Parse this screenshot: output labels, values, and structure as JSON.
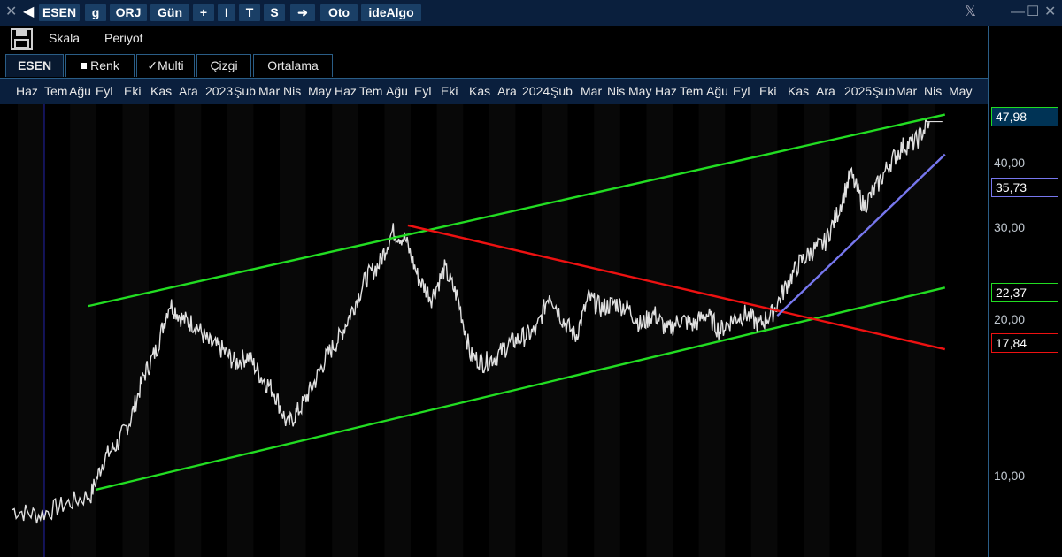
{
  "titlebar": {
    "buttons": [
      "ESEN",
      "g",
      "ORJ",
      "Gün",
      "+",
      "I",
      "T",
      "S",
      "Oto",
      "ideAlgo"
    ]
  },
  "toolbar": {
    "scale_label": "Skala",
    "period_label": "Periyot"
  },
  "tabs": [
    "ESEN",
    "Renk",
    "Multi",
    "Çizgi",
    "Ortalama"
  ],
  "months": [
    "Haz",
    "Tem",
    "Ağu",
    "Eyl",
    "Eki",
    "Kas",
    "Ara",
    "2023",
    "Şub",
    "Mar",
    "Nis",
    "May",
    "Haz",
    "Tem",
    "Ağu",
    "Eyl",
    "Eki",
    "Kas",
    "Ara",
    "2024",
    "Şub",
    "Mar",
    "Nis",
    "May",
    "Haz",
    "Tem",
    "Ağu",
    "Eyl",
    "Eki",
    "Kas",
    "Ara",
    "2025",
    "Şub",
    "Mar",
    "Nis",
    "May"
  ],
  "colors": {
    "upper_channel": "#22dd22",
    "lower_channel": "#22dd22",
    "resistance": "#ee1111",
    "support_trend": "#7777ee",
    "price": "#e0e0e0"
  },
  "chart_data": {
    "type": "line",
    "title": "",
    "xlabel": "",
    "ylabel": "",
    "scale": "log",
    "ylim": [
      8.5,
      52
    ],
    "y_ticks": [
      "10,00",
      "20,00",
      "30,00",
      "40,00"
    ],
    "y_tick_values": [
      10,
      20,
      30,
      40
    ],
    "x_start": "2022-06",
    "x_end": "2025-05",
    "series": [
      {
        "values": [
          [
            0,
            8.6
          ],
          [
            1,
            8.4
          ],
          [
            2,
            8.8
          ],
          [
            3,
            9.2
          ],
          [
            3.5,
            10.8
          ],
          [
            4,
            11.5
          ],
          [
            4.5,
            12.8
          ],
          [
            5,
            15.5
          ],
          [
            5.5,
            17.5
          ],
          [
            6,
            21.5
          ],
          [
            6.5,
            20.0
          ],
          [
            7,
            19.5
          ],
          [
            7.5,
            18.0
          ],
          [
            8,
            17.5
          ],
          [
            8.5,
            16.5
          ],
          [
            9,
            17.0
          ],
          [
            9.5,
            15.5
          ],
          [
            10,
            14.5
          ],
          [
            10.5,
            12.5
          ],
          [
            11,
            13.5
          ],
          [
            11.5,
            15.0
          ],
          [
            12,
            17.0
          ],
          [
            12.5,
            18.5
          ],
          [
            13,
            21.0
          ],
          [
            13.5,
            24.0
          ],
          [
            14,
            25.5
          ],
          [
            14.5,
            29.5
          ],
          [
            15,
            28.5
          ],
          [
            15.5,
            24.0
          ],
          [
            16,
            22.0
          ],
          [
            16.5,
            25.0
          ],
          [
            17,
            22.0
          ],
          [
            17.5,
            17.0
          ],
          [
            18,
            16.5
          ],
          [
            18.5,
            17.0
          ],
          [
            19,
            18.0
          ],
          [
            19.5,
            18.5
          ],
          [
            20,
            19.0
          ],
          [
            20.5,
            22.5
          ],
          [
            21,
            20.0
          ],
          [
            21.5,
            18.5
          ],
          [
            22,
            22.0
          ],
          [
            22.5,
            21.0
          ],
          [
            23,
            21.5
          ],
          [
            23.5,
            21.0
          ],
          [
            24,
            19.5
          ],
          [
            24.5,
            20.5
          ],
          [
            25,
            19.0
          ],
          [
            25.5,
            20.0
          ],
          [
            26,
            19.5
          ],
          [
            26.5,
            20.5
          ],
          [
            27,
            19.0
          ],
          [
            27.5,
            20.0
          ],
          [
            28,
            20.5
          ],
          [
            28.5,
            19.5
          ],
          [
            29,
            20.5
          ],
          [
            29.5,
            23.0
          ],
          [
            30,
            25.5
          ],
          [
            30.5,
            27.0
          ],
          [
            31,
            28.0
          ],
          [
            31.5,
            32.0
          ],
          [
            32,
            38.0
          ],
          [
            32.5,
            33.0
          ],
          [
            33,
            36.0
          ],
          [
            33.5,
            40.0
          ],
          [
            34,
            43.0
          ],
          [
            34.5,
            44.0
          ],
          [
            35,
            47.98
          ]
        ]
      }
    ],
    "annotations": [
      {
        "name": "upper-channel",
        "color": "green",
        "points": [
          [
            2.9,
            21.2
          ],
          [
            35.6,
            49.5
          ]
        ]
      },
      {
        "name": "lower-channel",
        "color": "green",
        "points": [
          [
            3.2,
            9.4
          ],
          [
            35.6,
            23.0
          ]
        ]
      },
      {
        "name": "resistance",
        "color": "red",
        "points": [
          [
            15.1,
            30.3
          ],
          [
            35.6,
            17.5
          ]
        ]
      },
      {
        "name": "support-trend",
        "color": "blue",
        "points": [
          [
            29.2,
            20.3
          ],
          [
            35.6,
            41.5
          ]
        ]
      },
      {
        "name": "last-price",
        "color": "white",
        "points": [
          [
            34.9,
            47.98
          ],
          [
            35.5,
            47.98
          ]
        ]
      }
    ],
    "price_labels": [
      {
        "text": "47,98",
        "value": 47.98,
        "border": "#22dd22",
        "bg": "#003355",
        "color": "#ffffff"
      },
      {
        "text": "35,73",
        "value": 35.73,
        "border": "#7777ee",
        "bg": "#000000",
        "color": "#ffffff"
      },
      {
        "text": "22,37",
        "value": 22.37,
        "border": "#22dd22",
        "bg": "#000000",
        "color": "#ffffff"
      },
      {
        "text": "17,84",
        "value": 17.84,
        "border": "#ee1111",
        "bg": "#000000",
        "color": "#ffffff"
      }
    ]
  }
}
